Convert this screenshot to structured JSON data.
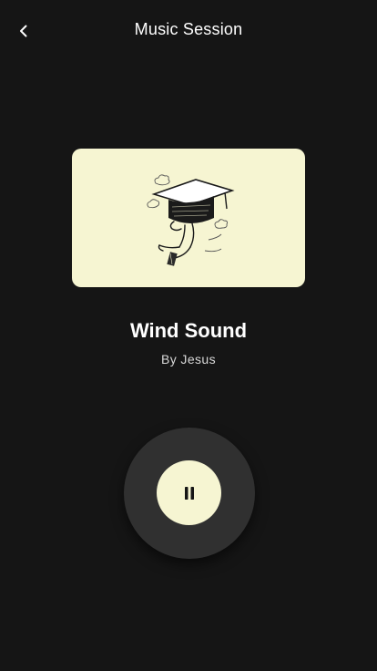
{
  "header": {
    "title": "Music Session",
    "back_icon": "chevron-left-icon"
  },
  "artwork": {
    "description_icon": "graduate-illustration",
    "background_color": "#f6f5d2"
  },
  "track": {
    "title": "Wind Sound",
    "artist": "By Jesus"
  },
  "controls": {
    "state": "playing",
    "pause_icon": "pause-icon",
    "accent_color": "#f6f5d2"
  }
}
